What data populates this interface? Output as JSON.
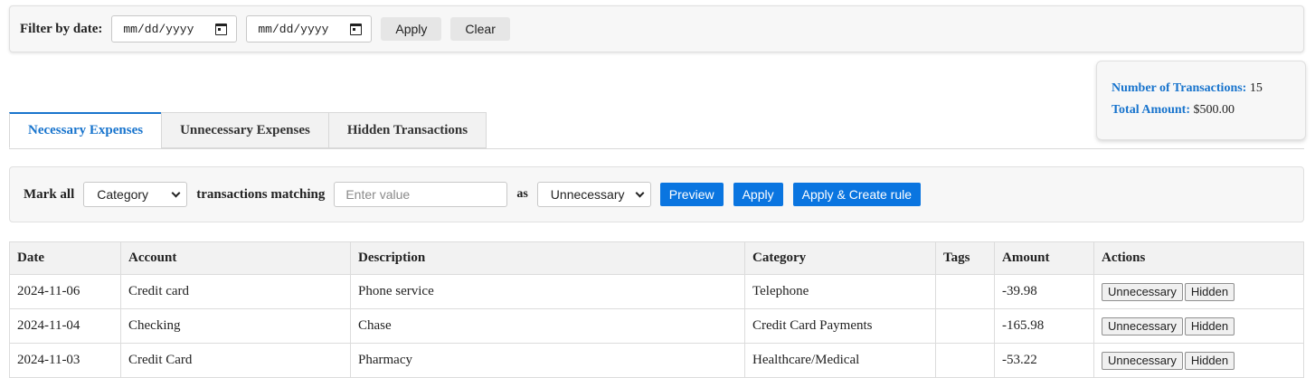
{
  "filter": {
    "label": "Filter by date:",
    "date_from_placeholder": "mm/dd/yyyy",
    "date_to_placeholder": "mm/dd/yyyy",
    "apply_label": "Apply",
    "clear_label": "Clear"
  },
  "summary": {
    "count_label": "Number of Transactions:",
    "count_value": "15",
    "total_label": "Total Amount:",
    "total_value": "$500.00"
  },
  "tabs": [
    {
      "label": "Necessary Expenses",
      "active": true
    },
    {
      "label": "Unnecessary Expenses",
      "active": false
    },
    {
      "label": "Hidden Transactions",
      "active": false
    }
  ],
  "rule": {
    "mark_all_label": "Mark all",
    "field_select_value": "Category",
    "matching_label": "transactions matching",
    "value_placeholder": "Enter value",
    "as_label": "as",
    "target_select_value": "Unnecessary",
    "preview_label": "Preview",
    "apply_label": "Apply",
    "apply_create_label": "Apply & Create rule"
  },
  "table": {
    "columns": [
      "Date",
      "Account",
      "Description",
      "Category",
      "Tags",
      "Amount",
      "Actions"
    ],
    "action_labels": {
      "unnecessary": "Unnecessary",
      "hidden": "Hidden"
    },
    "rows": [
      {
        "date": "2024-11-06",
        "account": "Credit card",
        "description": "Phone service",
        "category": "Telephone",
        "tags": "",
        "amount": "-39.98"
      },
      {
        "date": "2024-11-04",
        "account": "Checking",
        "description": "Chase",
        "category": "Credit Card Payments",
        "tags": "",
        "amount": "-165.98"
      },
      {
        "date": "2024-11-03",
        "account": "Credit Card",
        "description": "Pharmacy",
        "category": "Healthcare/Medical",
        "tags": "",
        "amount": "-53.22"
      }
    ]
  },
  "colors": {
    "accent": "#1874cd",
    "primary_button": "#0a75e0"
  }
}
